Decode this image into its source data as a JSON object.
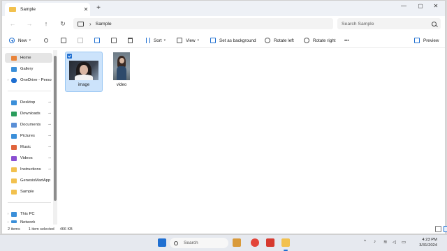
{
  "tab": {
    "title": "Sample",
    "close": "✕",
    "new_tab": "+"
  },
  "window_controls": {
    "minimize": "—",
    "maximize": "▢",
    "close": "✕"
  },
  "nav": {
    "back": "←",
    "forward": "→",
    "up": "↑",
    "refresh": "↻"
  },
  "address": {
    "chevron": "›",
    "crumb": "Sample"
  },
  "search": {
    "placeholder": "Search Sample"
  },
  "toolbar": {
    "new_label": "New",
    "sort_label": "Sort",
    "view_label": "View",
    "set_background_label": "Set as background",
    "rotate_left_label": "Rotate left",
    "rotate_right_label": "Rotate right",
    "more_label": "•••",
    "preview_label": "Preview"
  },
  "sidebar": {
    "items": [
      {
        "label": "Home",
        "icon": "home-icon",
        "color": "#e8833a"
      },
      {
        "label": "Gallery",
        "icon": "gallery-icon",
        "color": "#3b8fd9"
      },
      {
        "label": "OneDrive - Perso",
        "icon": "cloud-icon",
        "color": "#1f6fd1"
      },
      {
        "label": "Desktop",
        "icon": "desktop-icon",
        "color": "#3b8fd9"
      },
      {
        "label": "Downloads",
        "icon": "downloads-icon",
        "color": "#2a9d5c"
      },
      {
        "label": "Documents",
        "icon": "documents-icon",
        "color": "#5a8fd6"
      },
      {
        "label": "Pictures",
        "icon": "pictures-icon",
        "color": "#3b8fd9"
      },
      {
        "label": "Music",
        "icon": "music-icon",
        "color": "#e0643c"
      },
      {
        "label": "Videos",
        "icon": "videos-icon",
        "color": "#8a4fd1"
      },
      {
        "label": "Instructions",
        "icon": "folder-icon",
        "color": "#f2c14e"
      },
      {
        "label": "GenesisMartApp",
        "icon": "folder-icon",
        "color": "#f2c14e"
      },
      {
        "label": "Sample",
        "icon": "folder-icon",
        "color": "#f2c14e"
      },
      {
        "label": "This PC",
        "icon": "pc-icon",
        "color": "#3b8fd9"
      },
      {
        "label": "Network",
        "icon": "network-icon",
        "color": "#3b8fd9"
      }
    ],
    "pin": "📌",
    "expand": "›"
  },
  "files": [
    {
      "name": "image",
      "selected": true
    },
    {
      "name": "video",
      "selected": false
    }
  ],
  "status": {
    "count": "2 items",
    "selection": "1 item selected",
    "size": "466 KB"
  },
  "taskbar": {
    "search_placeholder": "Search",
    "tray_up": "^",
    "clock_time": "4:23 PM",
    "clock_date": "3/31/2024"
  },
  "colors": {
    "accent": "#1f6fd1",
    "selection": "#cce3fb",
    "folder": "#f2c14e"
  }
}
